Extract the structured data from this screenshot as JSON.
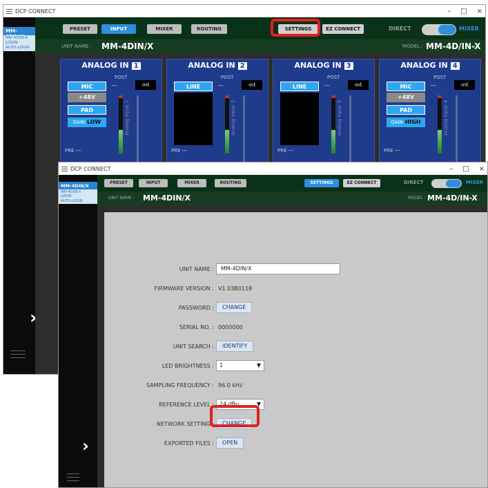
{
  "back_window": {
    "title": "DCP CONNECT",
    "window_controls": {
      "minimize": "–",
      "maximize": "□",
      "close": "×"
    },
    "sidebar": {
      "selected": "MM-4DIN/X",
      "items": [
        "MM-4D/IN-X",
        "LOGIN",
        "AUTO-LOGIN"
      ]
    },
    "tabs": {
      "preset": "PRESET",
      "input": "INPUT",
      "mixer": "MIXER",
      "routing": "ROUTING",
      "settings": "SETTINGS",
      "ez_connect": "EZ CONNECT"
    },
    "mode": {
      "direct": "DIRECT",
      "mixer": "MIXER"
    },
    "unit_name_label": "UNIT NAME :",
    "unit_name": "MM-4DIN/X",
    "model_label": "MODEL :",
    "model": "MM-4D/IN-X",
    "channels": [
      {
        "title": "ANALOG IN",
        "num": "1",
        "source": "MIC",
        "phantom": "+48V",
        "pad": "PAD",
        "gain_label": "GAIN",
        "gain": "LOW",
        "post": "POST",
        "post_value": "---",
        "level": "-inf.",
        "vlabel": "Analog Input 1",
        "pre": "PRE",
        "pre_value": "---"
      },
      {
        "title": "ANALOG IN",
        "num": "2",
        "source": "LINE",
        "post": "POST",
        "post_value": "---",
        "level": "-inf.",
        "vlabel": "Analog Input 2",
        "pre": "PRE",
        "pre_value": "---"
      },
      {
        "title": "ANALOG IN",
        "num": "3",
        "source": "LINE",
        "post": "POST",
        "post_value": "---",
        "level": "-inf.",
        "vlabel": "Analog Input 3",
        "pre": "PRE",
        "pre_value": "---"
      },
      {
        "title": "ANALOG IN",
        "num": "4",
        "source": "MIC",
        "phantom": "+48V",
        "pad": "PAD",
        "gain_label": "GAIN",
        "gain": "HIGH",
        "post": "POST",
        "post_value": "---",
        "level": "-inf.",
        "vlabel": "Analog Input 4",
        "pre": "PRE",
        "pre_value": "---"
      }
    ],
    "chevron": "›"
  },
  "front_window": {
    "title": "DCP CONNECT",
    "window_controls": {
      "minimize": "–",
      "maximize": "□",
      "close": "×"
    },
    "sidebar": {
      "selected": "MM-4DIN/X",
      "items": [
        "MM-4D/IN-X",
        "LOGIN",
        "AUTO-LOGIN"
      ]
    },
    "tabs": {
      "preset": "PRESET",
      "input": "INPUT",
      "mixer": "MIXER",
      "routing": "ROUTING",
      "settings": "SETTINGS",
      "ez_connect": "EZ CONNECT"
    },
    "mode": {
      "direct": "DIRECT",
      "mixer": "MIXER"
    },
    "unit_name_label": "UNIT NAME :",
    "unit_name": "MM-4DIN/X",
    "model_label": "MODEL :",
    "model": "MM-4D/IN-X",
    "settings": {
      "unit_name_label": "UNIT NAME :",
      "unit_name_value": "MM-4DIN/X",
      "firmware_label": "FIRMWARE VERSION :",
      "firmware_value": "V1.03B0118",
      "password_label": "PASSWORD :",
      "password_button": "CHANGE",
      "serial_label": "SERIAL NO. :",
      "serial_value": "0000000",
      "unit_search_label": "UNIT SEARCH :",
      "identify_button": "IDENTIFY",
      "led_label": "LED BRIGHTNESS :",
      "led_value": "1",
      "sampling_label": "SAMPLING FREQUENCY :",
      "sampling_value": "96.0 kHz",
      "reference_label": "REFERENCE LEVEL :",
      "reference_value": "24 dBu",
      "network_label": "NETWORK SETTING :",
      "network_button": "CHANGE",
      "exported_label": "EXPORTED FILES :",
      "exported_button": "OPEN"
    },
    "chevron": "›"
  },
  "colors": {
    "highlight": "#e02020",
    "accent": "#2f8de0",
    "dark_green": "#0a3218"
  },
  "icons": [
    "hamburger-icon",
    "dropdown-arrow-icon",
    "chevron-right-icon",
    "menu-lines-icon"
  ]
}
